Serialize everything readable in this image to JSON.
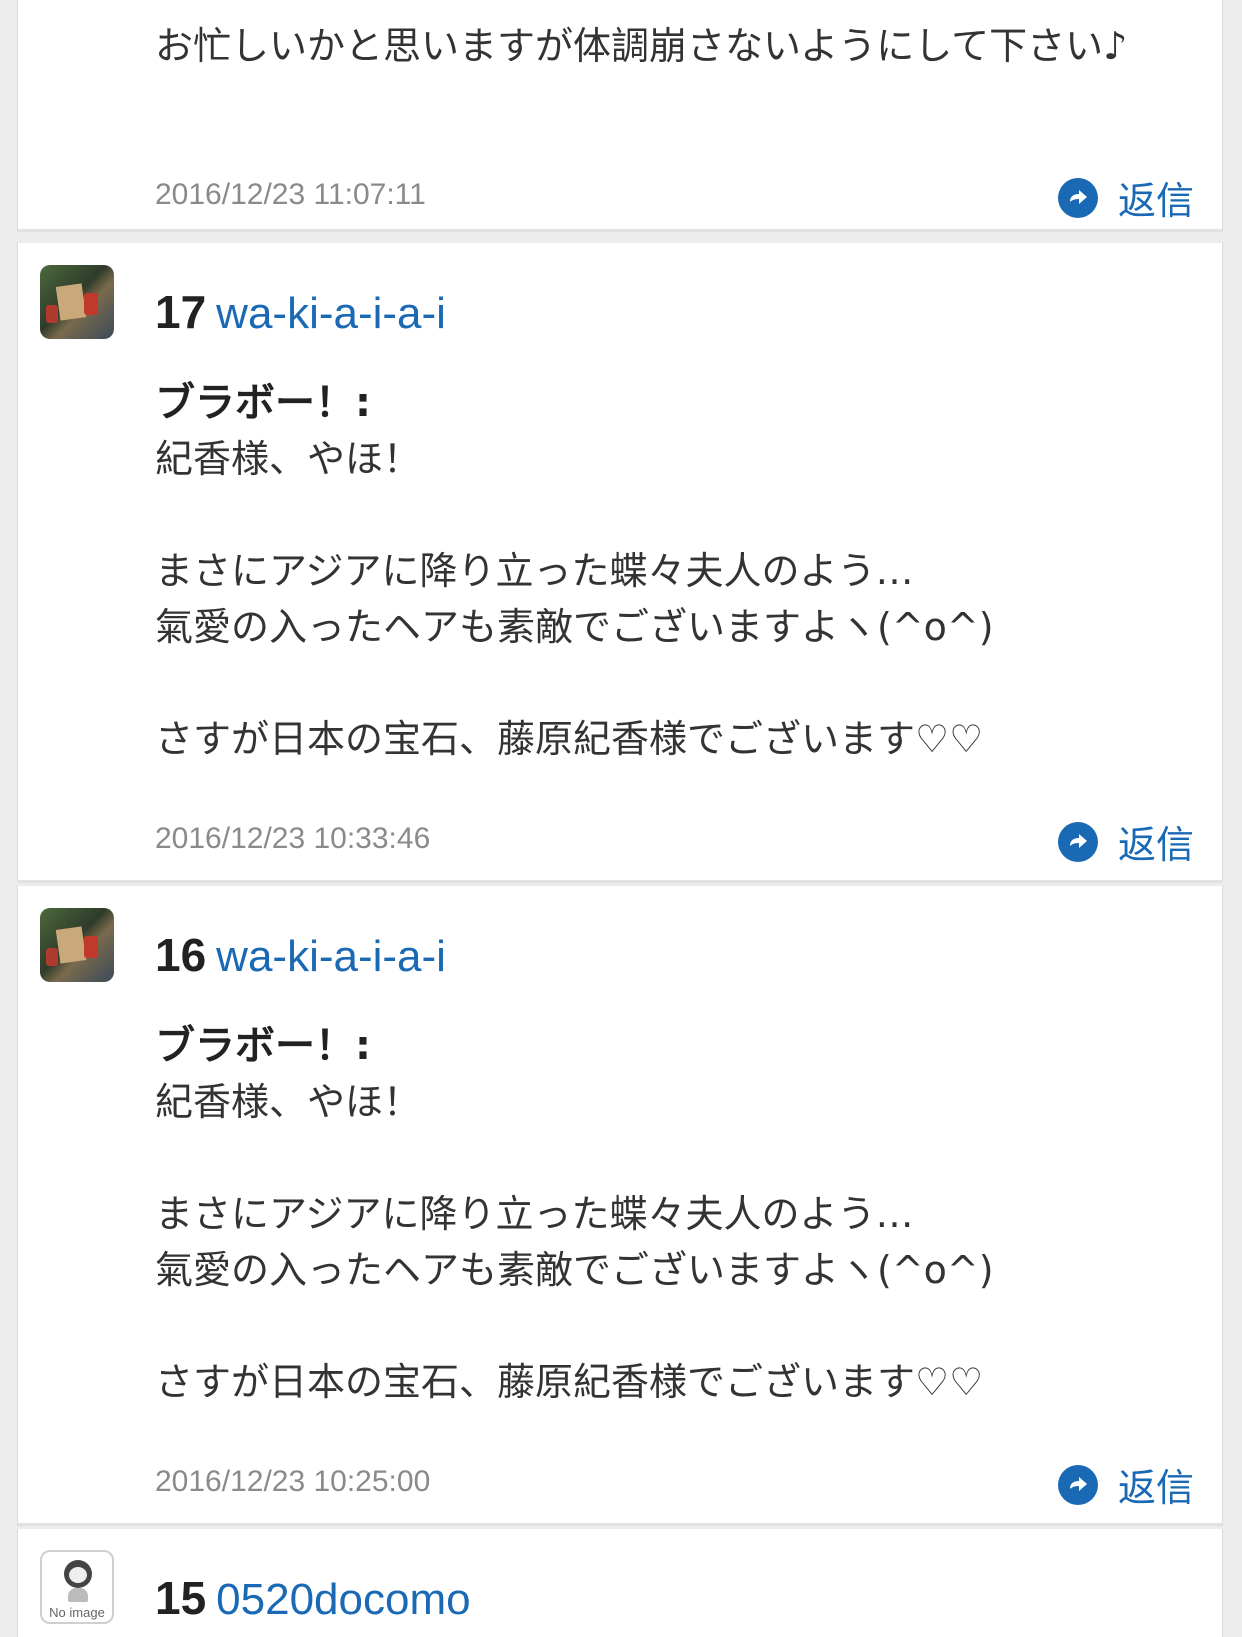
{
  "comments": [
    {
      "body": "お忙しいかと思いますが体調崩さないようにして下さい♪",
      "timestamp": "2016/12/23 11:07:11",
      "reply_label": "返信"
    },
    {
      "number": "17",
      "user": "wa-ki-a-i-a-i",
      "title": "ブラボー！:",
      "body": "紀香様、やほ！\n\nまさにアジアに降り立った蝶々夫人のよう…\n氣愛の入ったヘアも素敵でございますよヽ(^o^)\n\nさすが日本の宝石、藤原紀香様でございます♡♡",
      "timestamp": "2016/12/23 10:33:46",
      "reply_label": "返信"
    },
    {
      "number": "16",
      "user": "wa-ki-a-i-a-i",
      "title": "ブラボー！:",
      "body": "紀香様、やほ！\n\nまさにアジアに降り立った蝶々夫人のよう…\n氣愛の入ったヘアも素敵でございますよヽ(^o^)\n\nさすが日本の宝石、藤原紀香様でございます♡♡",
      "timestamp": "2016/12/23 10:25:00",
      "reply_label": "返信"
    },
    {
      "number": "15",
      "user": "0520docomo",
      "avatar_caption": "No image"
    }
  ],
  "colors": {
    "link": "#1a69b5",
    "text": "#333333",
    "timestamp": "#8a8a8a",
    "background": "#ececec"
  },
  "icons": {
    "reply": "reply-arrow-circle-icon"
  }
}
